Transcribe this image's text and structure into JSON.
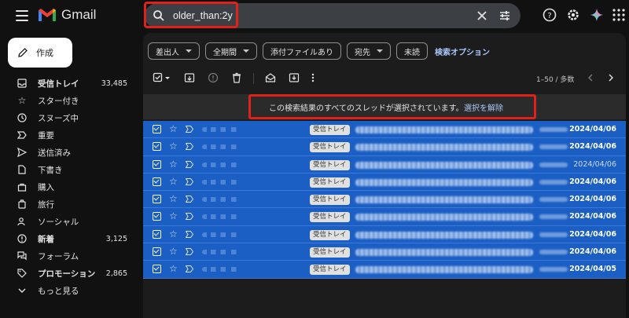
{
  "brand": {
    "name": "Gmail"
  },
  "search": {
    "value": "older_than:2y",
    "placeholder": ""
  },
  "compose": {
    "label": "作成"
  },
  "sidebar": {
    "items": [
      {
        "label": "受信トレイ",
        "count": "33,485",
        "bold": true,
        "icon": "inbox-icon"
      },
      {
        "label": "スター付き",
        "count": "",
        "bold": false,
        "icon": "star-icon"
      },
      {
        "label": "スヌーズ中",
        "count": "",
        "bold": false,
        "icon": "clock-icon"
      },
      {
        "label": "重要",
        "count": "",
        "bold": false,
        "icon": "important-icon"
      },
      {
        "label": "送信済み",
        "count": "",
        "bold": false,
        "icon": "send-icon"
      },
      {
        "label": "下書き",
        "count": "",
        "bold": false,
        "icon": "draft-icon"
      },
      {
        "label": "購入",
        "count": "",
        "bold": false,
        "icon": "purchase-icon"
      },
      {
        "label": "旅行",
        "count": "",
        "bold": false,
        "icon": "travel-icon"
      },
      {
        "label": "ソーシャル",
        "count": "",
        "bold": false,
        "icon": "social-icon"
      },
      {
        "label": "新着",
        "count": "3,125",
        "bold": true,
        "icon": "updates-icon"
      },
      {
        "label": "フォーラム",
        "count": "",
        "bold": false,
        "icon": "forum-icon"
      },
      {
        "label": "プロモーション",
        "count": "2,865",
        "bold": true,
        "icon": "promotion-icon"
      },
      {
        "label": "もっと見る",
        "count": "",
        "bold": false,
        "icon": "chevron-down-icon"
      }
    ]
  },
  "filters": {
    "chips": [
      "差出人",
      "全期間",
      "添付ファイルあり",
      "宛先",
      "未読"
    ],
    "advanced_link": "検索オプション"
  },
  "toolbar": {
    "page_info": "1–50 / 多数"
  },
  "banner": {
    "text": "この検索結果のすべてのスレッドが選択されています。",
    "link": "選択を解除"
  },
  "rows": [
    {
      "label": "受信トレイ",
      "date": "2024/04/06",
      "bold": true
    },
    {
      "label": "受信トレイ",
      "date": "2024/04/06",
      "bold": true
    },
    {
      "label": "受信トレイ",
      "date": "2024/04/06",
      "bold": false
    },
    {
      "label": "受信トレイ",
      "date": "2024/04/06",
      "bold": true
    },
    {
      "label": "受信トレイ",
      "date": "2024/04/06",
      "bold": true
    },
    {
      "label": "受信トレイ",
      "date": "2024/04/06",
      "bold": true
    },
    {
      "label": "受信トレイ",
      "date": "2024/04/06",
      "bold": true
    },
    {
      "label": "受信トレイ",
      "date": "2024/04/06",
      "bold": true
    },
    {
      "label": "受信トレイ",
      "date": "2024/04/05",
      "bold": true
    }
  ],
  "colors": {
    "selected_row": "#1b5fc4",
    "highlight_box": "#e0201b",
    "link": "#a8c7fa"
  }
}
